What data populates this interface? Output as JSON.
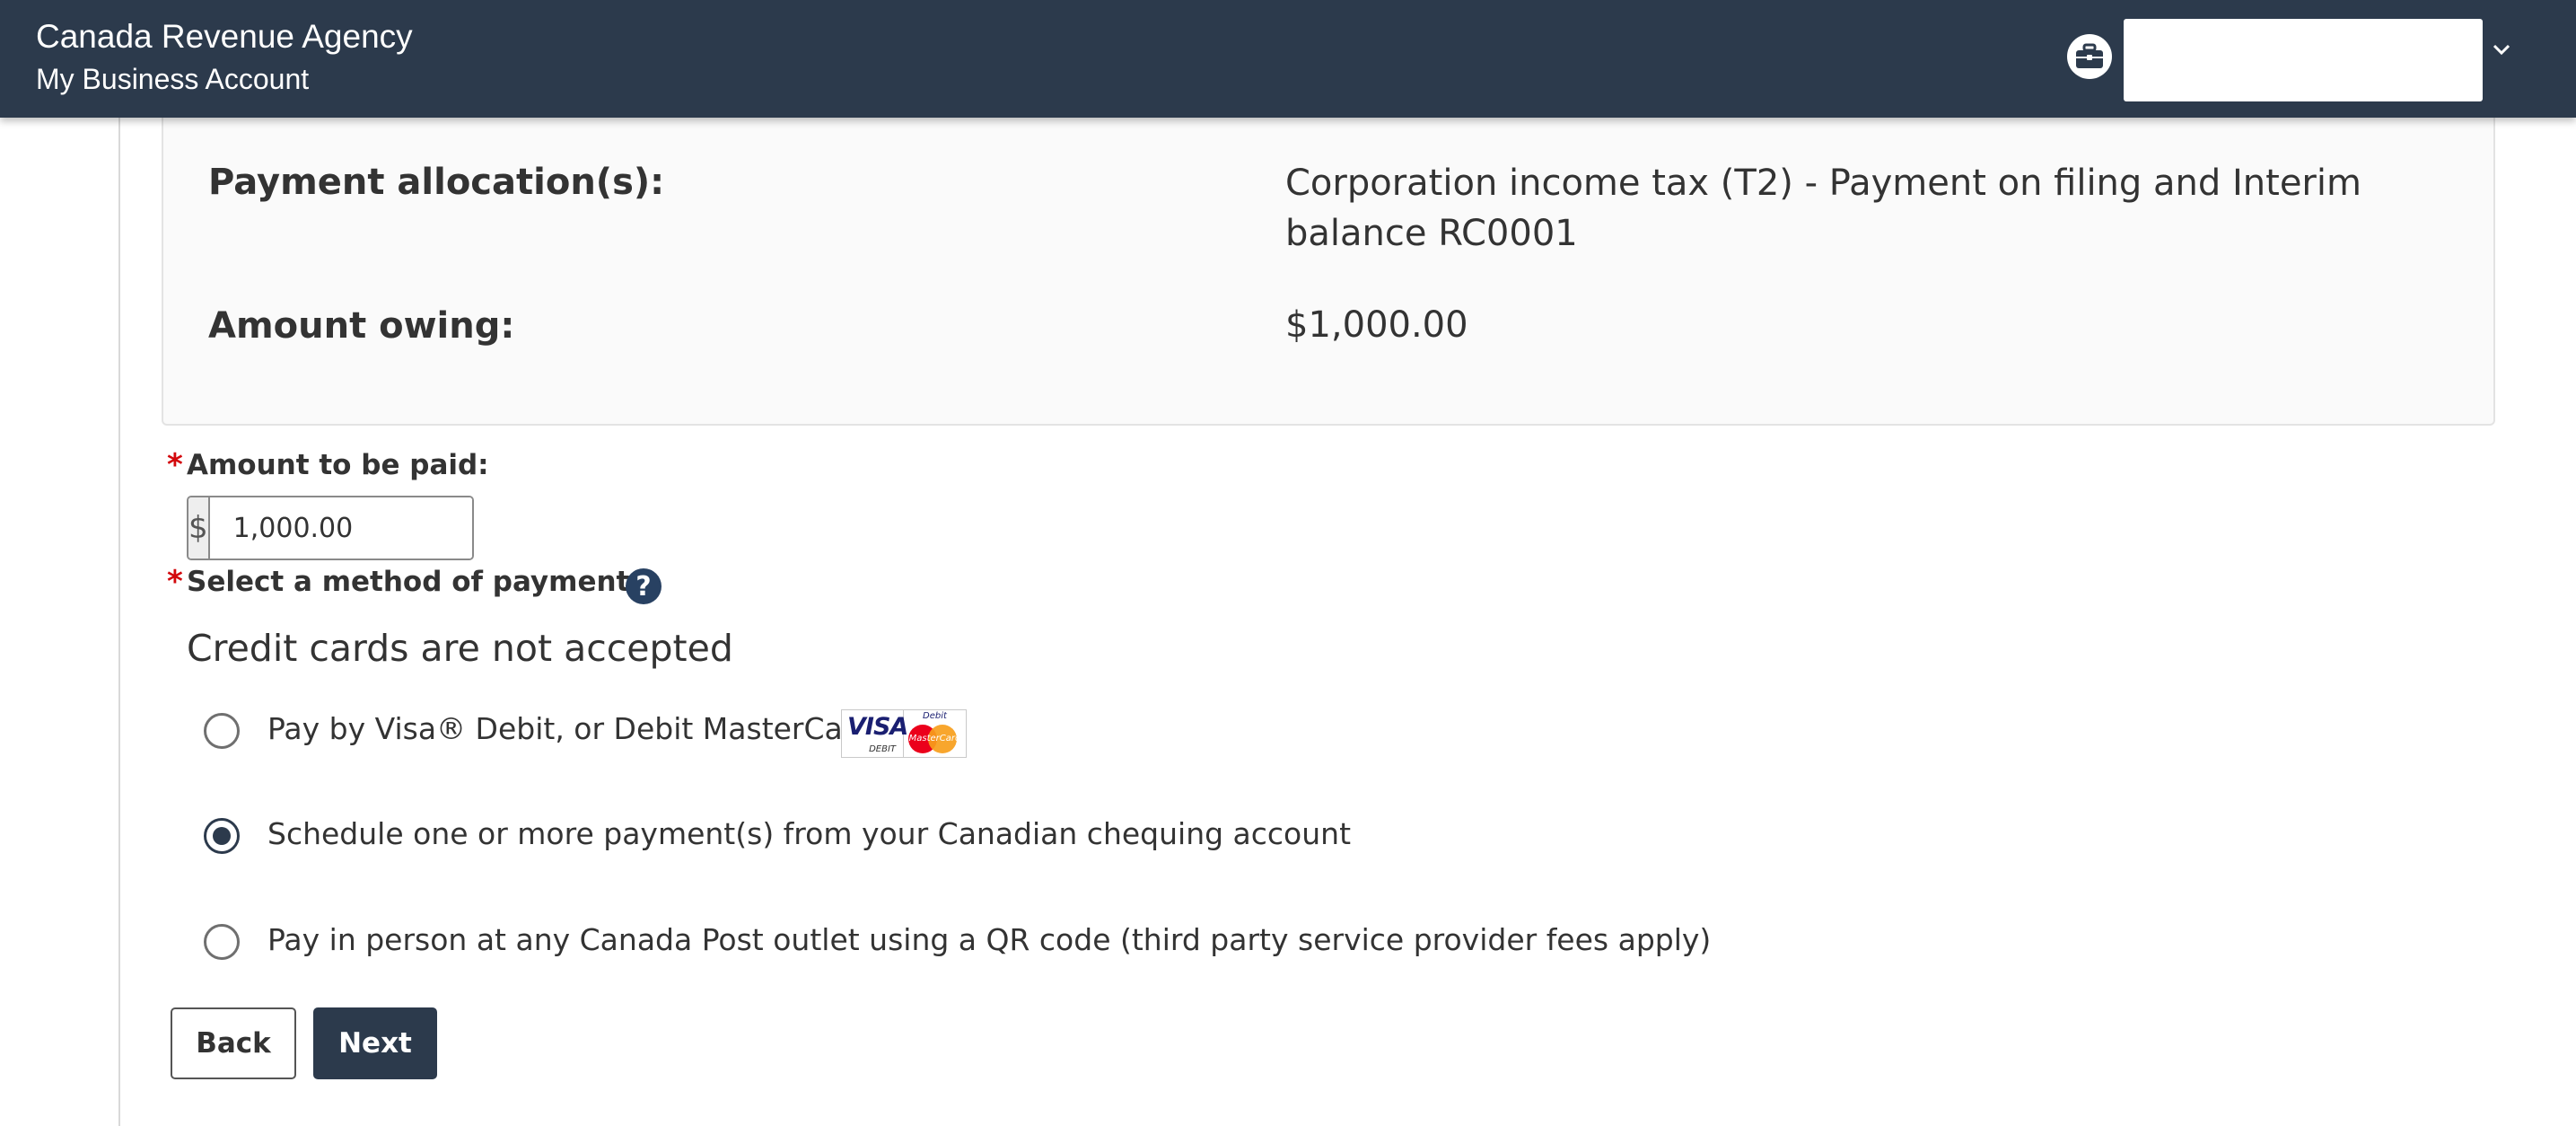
{
  "header": {
    "agency_name": "Canada Revenue Agency",
    "account_name": "My Business Account",
    "profile_icon": "briefcase-icon",
    "account_menu_icon": "chevron-down-icon"
  },
  "summary": {
    "allocation_label": "Payment allocation(s):",
    "allocation_value": "Corporation income tax (T2) - Payment on filing and Interim balance RC0001",
    "owing_label": "Amount owing:",
    "owing_value": "$1,000.00"
  },
  "form": {
    "required_marker": "*",
    "amount_label": "Amount to be paid:",
    "currency_prefix": "$",
    "amount_value": "1,000.00",
    "method_label": "Select a method of payment:",
    "help_icon": "question-mark-icon",
    "help_glyph": "?",
    "notice": "Credit cards are not accepted",
    "payment_options": [
      {
        "label": "Pay by Visa® Debit, or Debit MasterCard®",
        "selected": false
      },
      {
        "label": "Schedule one or more payment(s) from your Canadian chequing account",
        "selected": true
      },
      {
        "label": "Pay in person at any Canada Post outlet using a QR code (third party service provider fees apply)",
        "selected": false
      }
    ],
    "card_logos": {
      "visa_text": "VISA",
      "visa_sub": "DEBIT",
      "mc_top": "Debit",
      "mc_text": "MasterCard"
    }
  },
  "actions": {
    "back_label": "Back",
    "next_label": "Next"
  },
  "colors": {
    "header_bg": "#2c3a4c",
    "required": "#d3080c",
    "help_icon_bg": "#284162"
  }
}
